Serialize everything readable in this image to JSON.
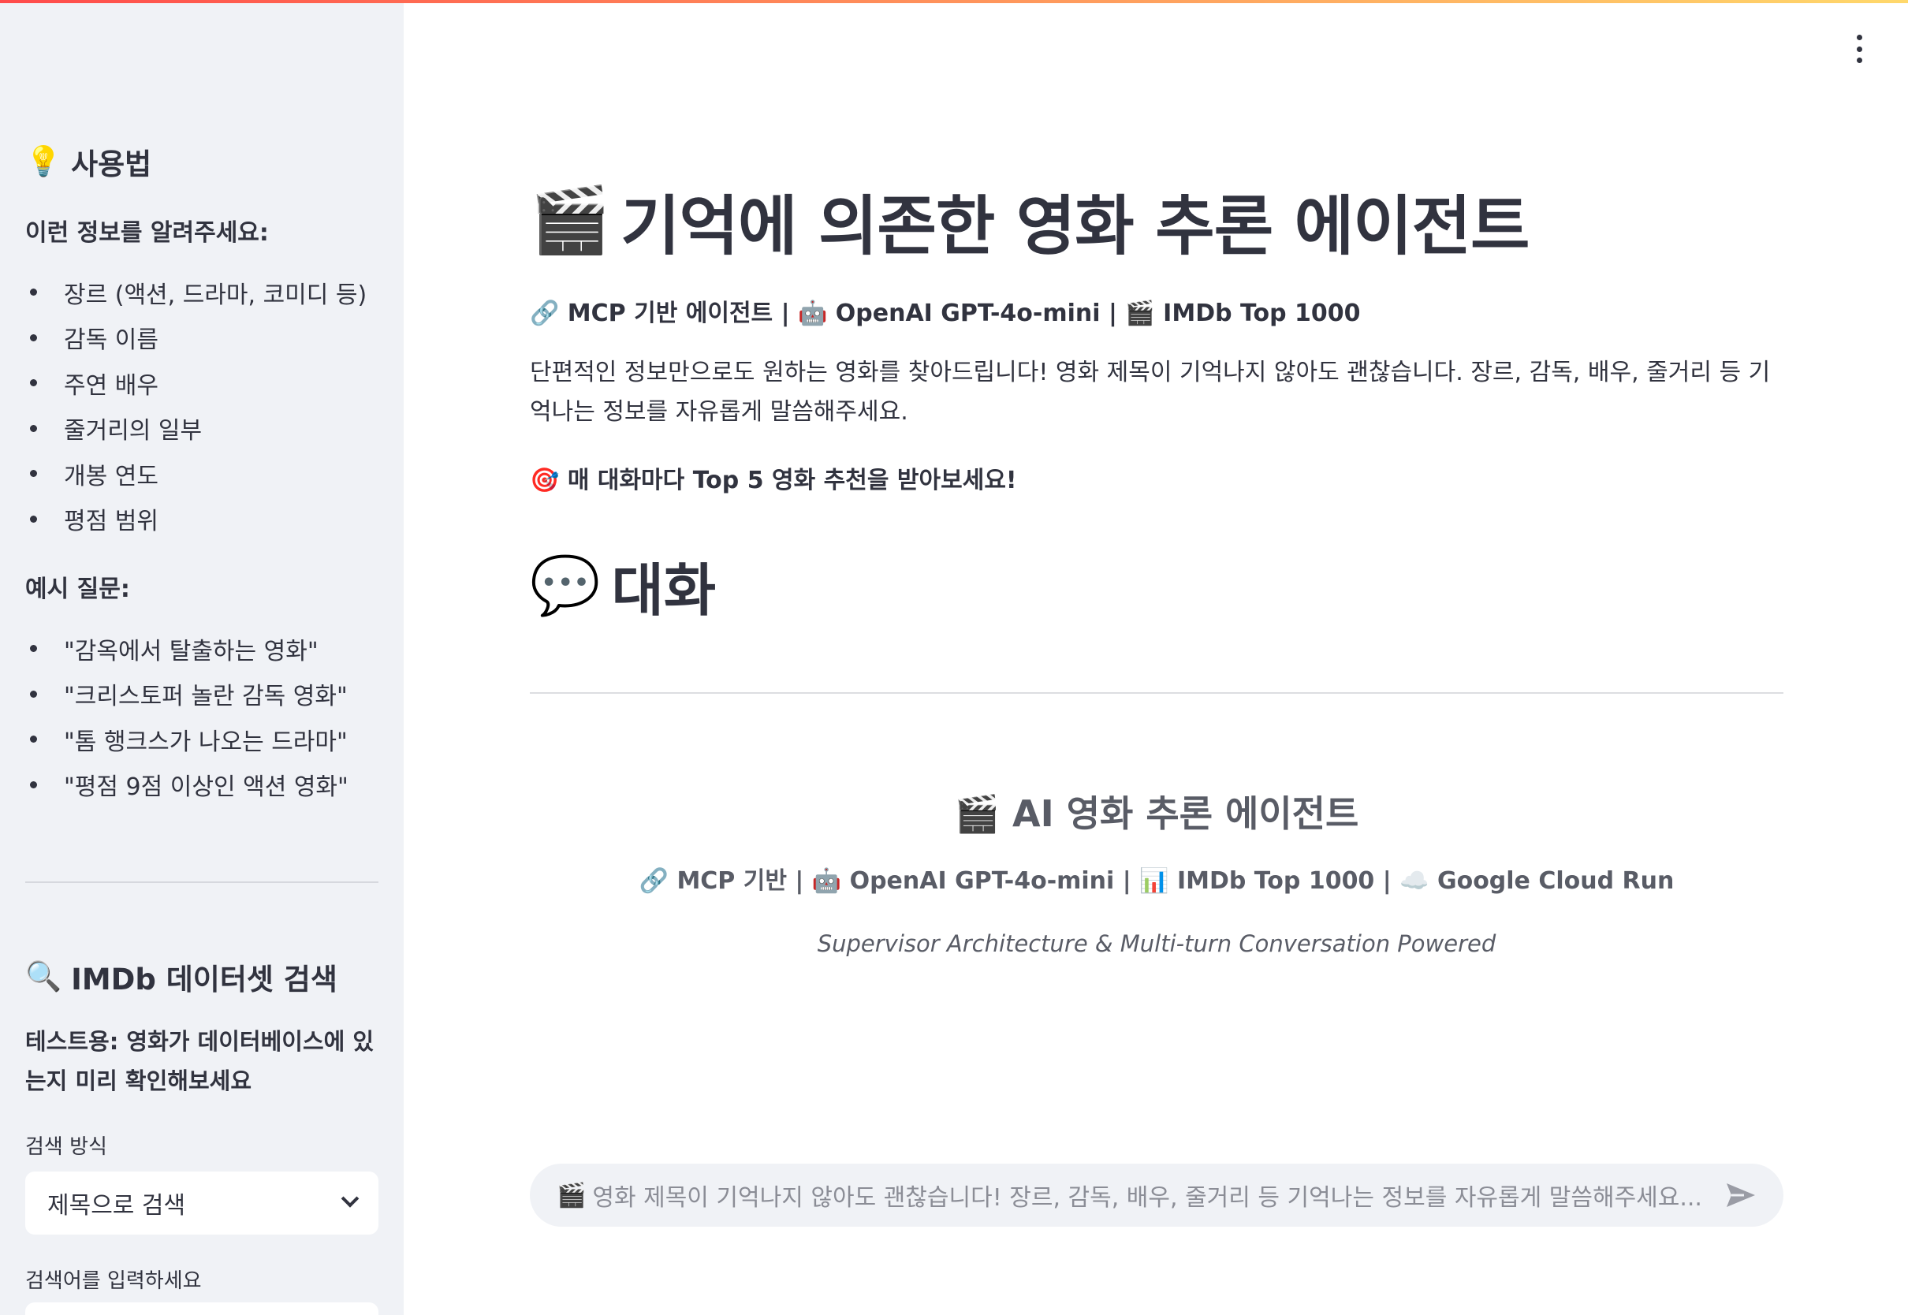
{
  "sidebar": {
    "usage_title": "사용법",
    "usage_icon": "lightbulb-icon",
    "info_prompt": "이런 정보를 알려주세요:",
    "info_items": [
      "장르 (액션, 드라마, 코미디 등)",
      "감독 이름",
      "주연 배우",
      "줄거리의 일부",
      "개봉 연도",
      "평점 범위"
    ],
    "example_title": "예시 질문:",
    "example_items": [
      "\"감옥에서 탈출하는 영화\"",
      "\"크리스토퍼 놀란 감독 영화\"",
      "\"톰 행크스가 나오는 드라마\"",
      "\"평점 9점 이상인 액션 영화\""
    ],
    "search_title": "IMDb 데이터셋 검색",
    "search_icon": "magnifier-icon",
    "search_desc": "테스트용: 영화가 데이터베이스에 있는지 미리 확인해보세요",
    "search_mode_label": "검색 방식",
    "search_mode_value": "제목으로 검색",
    "search_input_label": "검색어를 입력하세요"
  },
  "main": {
    "title": "기억에 의존한 영화 추론 에이전트",
    "title_icon": "clapperboard-icon",
    "badges": "🔗 MCP 기반 에이전트 | 🤖 OpenAI GPT-4o-mini | 🎬 IMDb Top 1000",
    "intro": "단편적인 정보만으로도 원하는 영화를 찾아드립니다! 영화 제목이 기억나지 않아도 괜찮습니다. 장르, 감독, 배우, 줄거리 등 기억나는 정보를 자유롭게 말씀해주세요.",
    "cta": "매 대화마다 Top 5 영화 추천을 받아보세요!",
    "cta_icon": "target-icon",
    "conversation_title": "대화",
    "conversation_icon": "speech-bubble-icon",
    "footer_title": "AI 영화 추론 에이전트",
    "footer_badges": "🔗 MCP 기반 | 🤖 OpenAI GPT-4o-mini | 📊 IMDb Top 1000 | ☁️ Google Cloud Run",
    "footer_tagline": "Supervisor Architecture & Multi-turn Conversation Powered"
  },
  "chat": {
    "placeholder": "영화 제목이 기억나지 않아도 괜찮습니다! 장르, 감독, 배우, 줄거리 등 기억나는 정보를 자유롭게 말씀해주세요...",
    "placeholder_icon": "clapperboard-icon",
    "send_icon": "send-icon"
  },
  "colors": {
    "sidebar_bg": "#f0f2f6",
    "text": "#31333f",
    "muted": "#595c66",
    "accent_gradient": [
      "#ff4b4b",
      "#ffd86b"
    ]
  }
}
